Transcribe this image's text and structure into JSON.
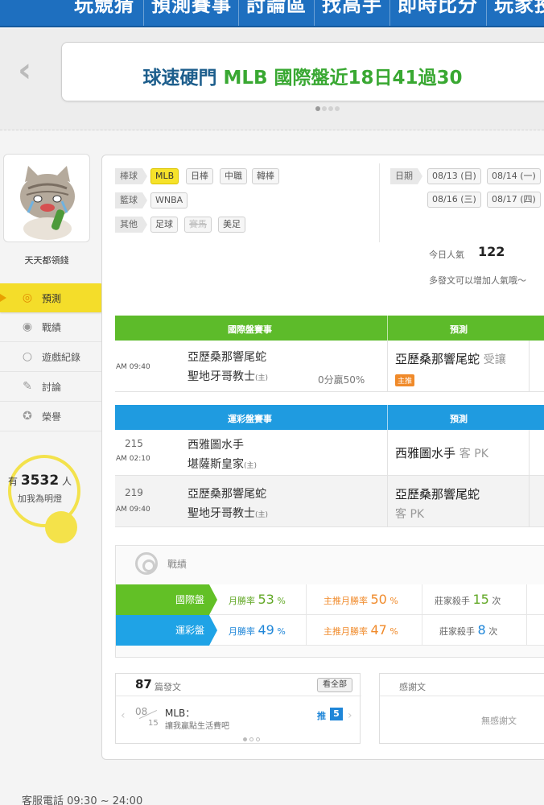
{
  "topnav": {
    "items": [
      "玩競猜",
      "預測賽事",
      "討論區",
      "找高手",
      "即時比分",
      "玩家投"
    ]
  },
  "banner": {
    "prefix": "球速硬門",
    "highlight": "MLB 國際盤近18日41過30"
  },
  "user": {
    "name": "天天都領錢"
  },
  "menu": {
    "items": [
      {
        "label": "預測",
        "icon": "target-icon"
      },
      {
        "label": "戰績",
        "icon": "record-icon"
      },
      {
        "label": "遊戲紀錄",
        "icon": "circle-icon"
      },
      {
        "label": "討論",
        "icon": "pencil-icon"
      },
      {
        "label": "榮譽",
        "icon": "medal-icon"
      }
    ]
  },
  "fans": {
    "prefix": "有",
    "count": "3532",
    "suffix": "人",
    "cta": "加我為明燈"
  },
  "filters": {
    "baseball_label": "棒球",
    "baseball": [
      "MLB",
      "日棒",
      "中職",
      "韓棒"
    ],
    "basketball_label": "籃球",
    "basketball": [
      "WNBA"
    ],
    "other_label": "其他",
    "other": [
      "足球",
      "賽馬",
      "美足"
    ],
    "date_label": "日期",
    "dates": [
      "08/13 (日)",
      "08/14 (一)",
      "08/16 (三)",
      "08/17 (四)"
    ]
  },
  "popularity": {
    "label": "今日人氣",
    "value": "122",
    "hint": "多發文可以增加人氣哦～"
  },
  "intl_table": {
    "header_event": "國際盤賽事",
    "header_pick": "預測",
    "header_color": "#5dbb2a",
    "rows": [
      {
        "num": "",
        "time": "AM 09:40",
        "away": "亞歷桑那響尾蛇",
        "home": "聖地牙哥教士",
        "home_tag": "(主)",
        "handicap": "0分贏50%",
        "pick": "亞歷桑那響尾蛇",
        "pick_sub": "受讓",
        "badge": "主推"
      }
    ]
  },
  "sports_table": {
    "header_event": "運彩盤賽事",
    "header_pick": "預測",
    "header_color": "#1f9be0",
    "rows": [
      {
        "num": "215",
        "time": "AM 02:10",
        "away": "西雅圖水手",
        "home": "堪薩斯皇家",
        "home_tag": "(主)",
        "pick": "西雅圖水手",
        "pick_sub": "客 PK"
      },
      {
        "num": "219",
        "time": "AM 09:40",
        "away": "亞歷桑那響尾蛇",
        "home": "聖地牙哥教士",
        "home_tag": "(主)",
        "pick": "亞歷桑那響尾蛇",
        "pick_sub": "客 PK"
      }
    ]
  },
  "record": {
    "title": "戰績",
    "rows": [
      {
        "tag": "國際盤",
        "color": "#62c026",
        "month_label": "月勝率",
        "month": "53",
        "main_label": "主推月勝率",
        "main": "50",
        "streak_label": "莊家殺手",
        "streak": "15",
        "streak_unit": "次"
      },
      {
        "tag": "運彩盤",
        "color": "#1fa3e6",
        "month_label": "月勝率",
        "month": "49",
        "main_label": "主推月勝率",
        "main": "47",
        "streak_label": "莊家殺手",
        "streak": "8",
        "streak_unit": "次"
      }
    ]
  },
  "posts": {
    "count": "87",
    "label": "篇發文",
    "see_all": "看全部",
    "item": {
      "date_month": "08",
      "date_day": "15",
      "title": "MLB：",
      "body": "讓我贏點生活費吧",
      "push_label": "推",
      "push_count": "5"
    }
  },
  "thanks": {
    "title": "感謝文",
    "empty": "無感謝文"
  },
  "footer": {
    "phone": "客服電話 09:30 ~ 24:00"
  },
  "colors": {
    "nav": "#1e6fbf",
    "green": "#5dbb2a",
    "blue": "#1f9be0",
    "yellow": "#f4dd2a",
    "accent_orange": "#f08a2a"
  }
}
